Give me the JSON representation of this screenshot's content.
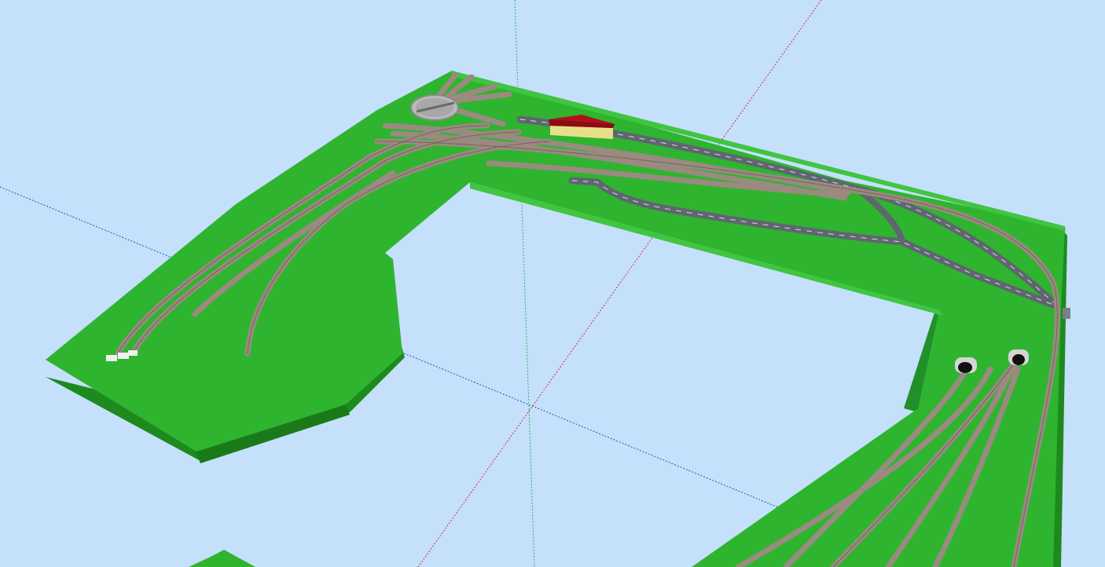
{
  "colors": {
    "sky": "#c4e0fb",
    "grass": "#2fb42f",
    "grass_light": "#40c540",
    "grass_dark": "#1e8a1e",
    "ballast": "#9a8a80",
    "rail": "#5a4d48",
    "road": "#5f6670",
    "road_mark": "#d8dde2",
    "roof": "#b0101a",
    "wall": "#e7e08a",
    "turntable": "#b9b9b9",
    "tunnel_portal": "#d5d5d5",
    "axis_red": "#d03030",
    "axis_green": "#30b060",
    "axis_blue": "#3050b0"
  },
  "scene": {
    "objects": [
      "layout-baseboard",
      "track-yard",
      "turntable",
      "station-building",
      "road",
      "tunnel-portal-left",
      "tunnel-portal-right",
      "axis-red",
      "axis-green",
      "axis-blue"
    ]
  }
}
